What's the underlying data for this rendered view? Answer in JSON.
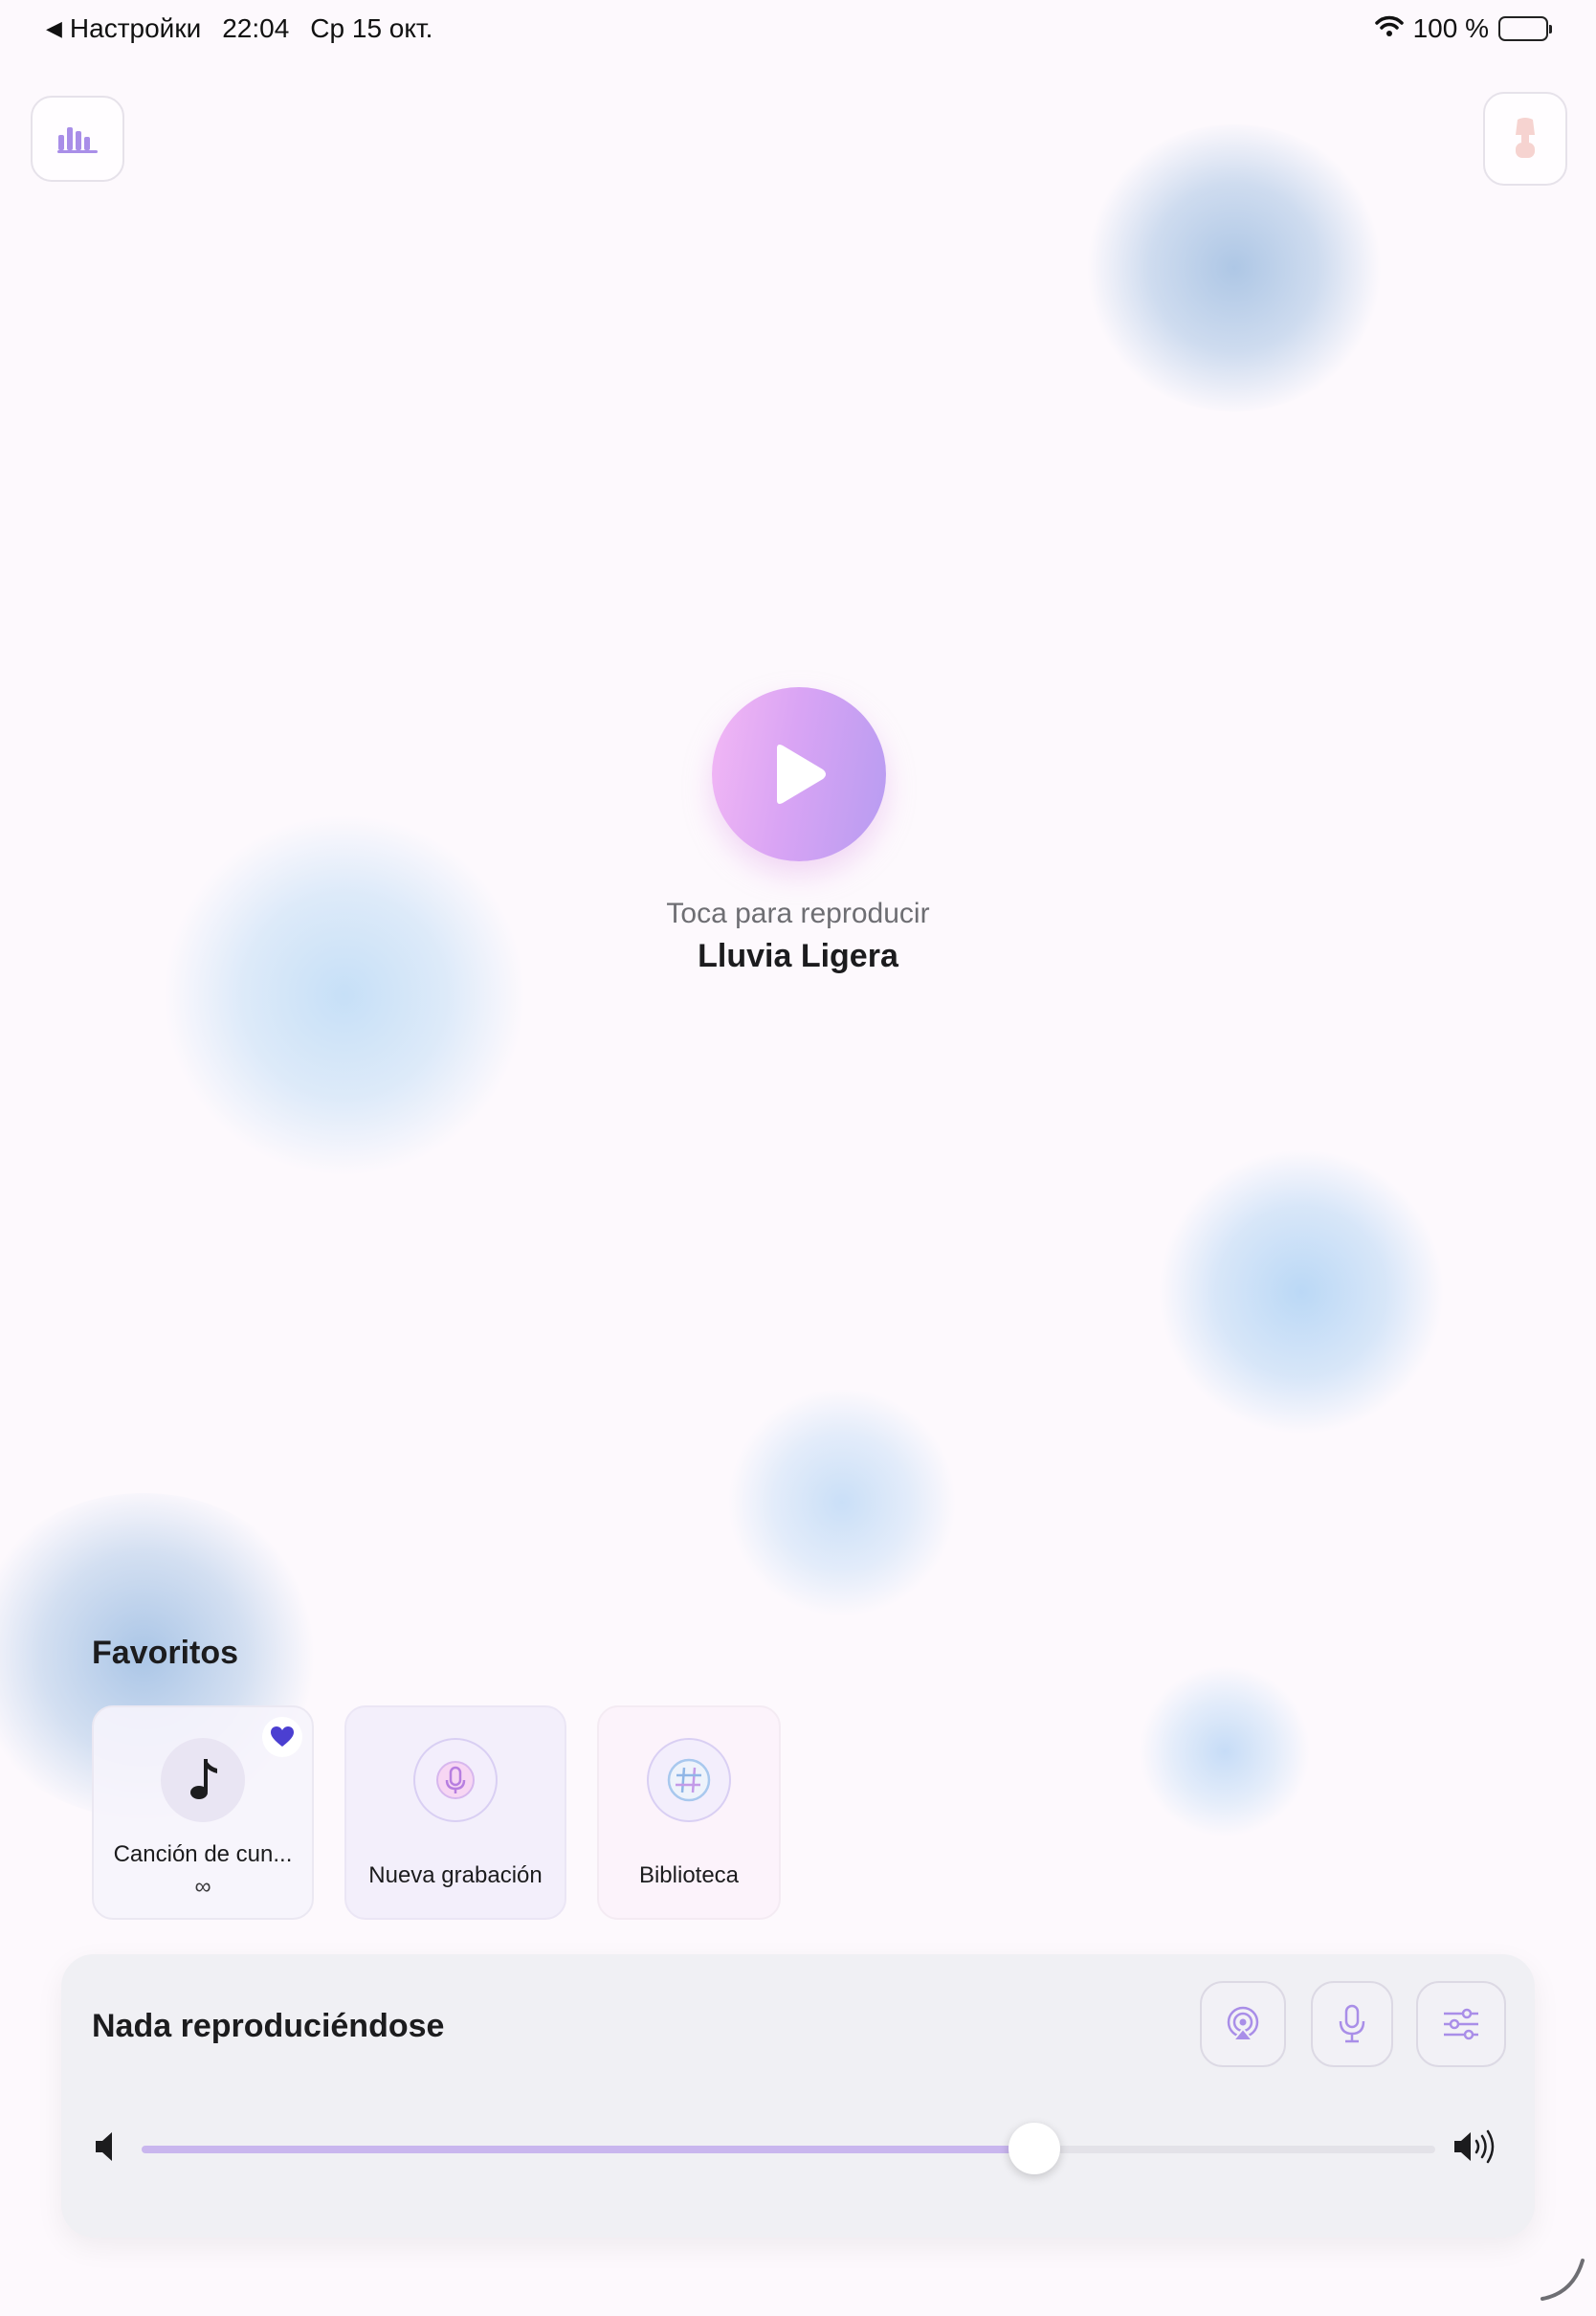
{
  "status_bar": {
    "back_label": "Настройки",
    "time": "22:04",
    "date": "Ср 15 окт.",
    "battery": "100 %"
  },
  "header": {
    "left_button_icon": "chart-bars-icon",
    "right_button_icon": "lamp-icon"
  },
  "player": {
    "tap_hint": "Toca para reproducir",
    "sound_name": "Lluvia Ligera"
  },
  "favorites": {
    "title": "Favoritos",
    "items": [
      {
        "label": "Canción de cun...",
        "sub": "∞",
        "icon": "music-note-icon",
        "favorited": true
      },
      {
        "label": "Nueva grabación",
        "icon": "microphone-icon"
      },
      {
        "label": "Biblioteca",
        "icon": "hashtag-icon"
      }
    ]
  },
  "now_playing": {
    "title": "Nada reproduciéndose",
    "controls": [
      "airplay-icon",
      "microphone-icon",
      "sliders-icon"
    ],
    "volume": 0.69
  },
  "colors": {
    "accent": "#b79cf1",
    "accent_pink": "#f3b8f5",
    "heart": "#4b3fd1",
    "icon_purple": "#a98ee8"
  }
}
